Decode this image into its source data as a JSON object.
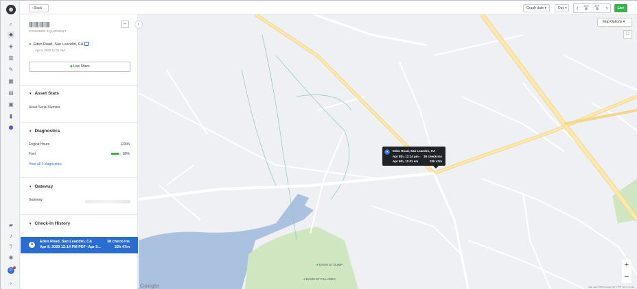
{
  "topbar": {
    "back_label": "Back",
    "graph_date_label": "Graph date ▾",
    "day_label": "Day ▾",
    "date_from": {
      "month": "APR",
      "day": "8"
    },
    "date_to": {
      "month": "APR",
      "day": "9"
    },
    "live_label": "Live"
  },
  "asset": {
    "type": "POWERED EQUIPMENT",
    "location": "Eden Road, San Leandro, CA",
    "location_time": "Apr 9, 2020 11:01 AM",
    "share_label": "Live Share"
  },
  "sections": {
    "asset_stats": {
      "title": "Asset Stats",
      "serial_label": "Asset Serial Number"
    },
    "diagnostics": {
      "title": "Diagnostics",
      "engine_hours_label": "Engine Hours",
      "engine_hours_value": "12335",
      "fuel_label": "Fuel",
      "fuel_value": "80%",
      "fuel_fraction": 0.8,
      "view_all_label": "View all 2 diagnostics"
    },
    "gateway": {
      "title": "Gateway",
      "gateway_label": "Gateway"
    },
    "checkin": {
      "title": "Check-In History",
      "row": {
        "badge": "A",
        "location": "Eden Road, San Leandro, CA",
        "range": "Apr 8, 2020 12:14 PM PDT–Apr 9...",
        "checkins": "38 check-ins",
        "duration": "22h 47m"
      }
    }
  },
  "map": {
    "options_label": "Map Options ▾",
    "tooltip": {
      "badge": "A",
      "title": "Eden Road, San Leandro, CA",
      "line1_left": "Apr 8th, 12:14 pm -",
      "line1_right": "38 check-ins",
      "line2_left": "Apr 9th, 11:01 am",
      "line2_right": "22h 47m"
    },
    "pois": {
      "dump": "DAVIS ST DUMP",
      "fill": "DAVIS ST FILL AREA"
    },
    "google_label": "Google",
    "attribution": "Map data ©2020 Google   100 m ┗━┛   Terms of Use"
  }
}
